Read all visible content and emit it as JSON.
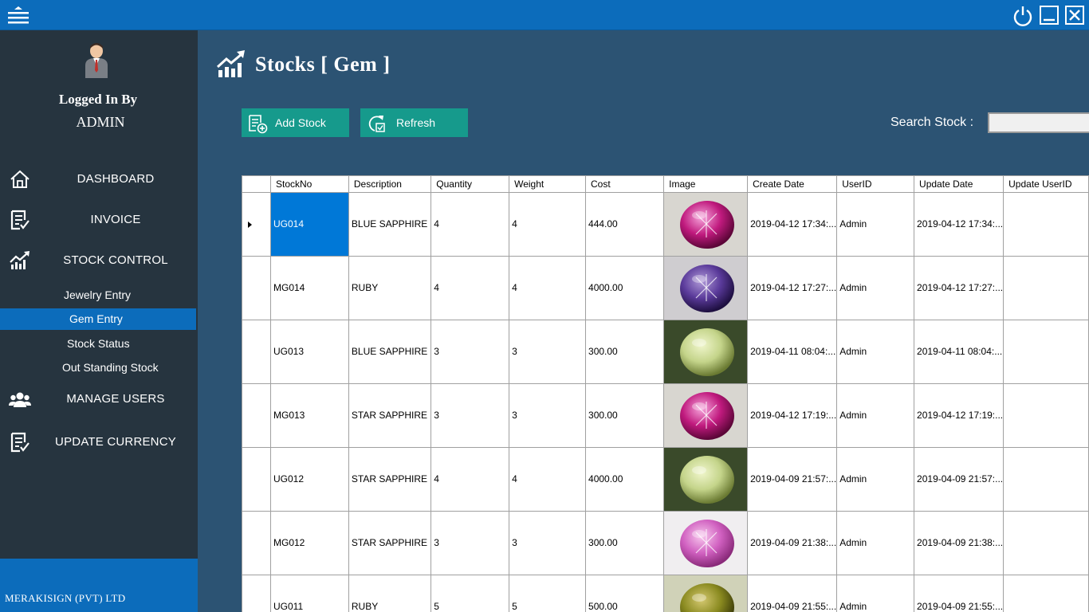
{
  "sidebar": {
    "logged_label": "Logged In By",
    "user": "ADMIN",
    "nav": {
      "dashboard": "DASHBOARD",
      "invoice": "INVOICE",
      "stock_control": "STOCK CONTROL",
      "manage_users": "MANAGE USERS",
      "update_currency": "UPDATE CURRENCY"
    },
    "sub": {
      "jewelry": "Jewelry Entry",
      "gem": "Gem Entry",
      "status": "Stock Status",
      "outstanding": "Out Standing Stock"
    },
    "company": "MERAKISIGN (PVT) LTD"
  },
  "page_title": "Stocks [ Gem ]",
  "toolbar": {
    "add_label": "Add Stock",
    "refresh_label": "Refresh",
    "search_label": "Search Stock  :",
    "search_value": ""
  },
  "table": {
    "columns": {
      "stockno": "StockNo",
      "description": "Description",
      "quantity": "Quantity",
      "weight": "Weight",
      "cost": "Cost",
      "image": "Image",
      "create_date": "Create Date",
      "userid": "UserID",
      "update_date": "Update Date",
      "update_userid": "Update UserID"
    },
    "rows": [
      {
        "stockno": "UG014",
        "description": "BLUE SAPPHIRE",
        "quantity": "4",
        "weight": "4",
        "cost": "444.00",
        "create_date": "2019-04-12 17:34:...",
        "userid": "Admin",
        "update_date": "2019-04-12 17:34:...",
        "update_userid": "",
        "gem": "pink-star"
      },
      {
        "stockno": "MG014",
        "description": "RUBY",
        "quantity": "4",
        "weight": "4",
        "cost": "4000.00",
        "create_date": "2019-04-12 17:27:...",
        "userid": "Admin",
        "update_date": "2019-04-12 17:27:...",
        "update_userid": "",
        "gem": "purple-star"
      },
      {
        "stockno": "UG013",
        "description": "BLUE SAPPHIRE",
        "quantity": "3",
        "weight": "3",
        "cost": "300.00",
        "create_date": "2019-04-11 08:04:...",
        "userid": "Admin",
        "update_date": "2019-04-11 08:04:...",
        "update_userid": "",
        "gem": "green-cabochon"
      },
      {
        "stockno": "MG013",
        "description": "STAR SAPPHIRE",
        "quantity": "3",
        "weight": "3",
        "cost": "300.00",
        "create_date": "2019-04-12 17:19:...",
        "userid": "Admin",
        "update_date": "2019-04-12 17:19:...",
        "update_userid": "",
        "gem": "pink-star"
      },
      {
        "stockno": "UG012",
        "description": "STAR SAPPHIRE",
        "quantity": "4",
        "weight": "4",
        "cost": "4000.00",
        "create_date": "2019-04-09 21:57:...",
        "userid": "Admin",
        "update_date": "2019-04-09 21:57:...",
        "update_userid": "",
        "gem": "green-cabochon"
      },
      {
        "stockno": "MG012",
        "description": "STAR SAPPHIRE",
        "quantity": "3",
        "weight": "3",
        "cost": "300.00",
        "create_date": "2019-04-09 21:38:...",
        "userid": "Admin",
        "update_date": "2019-04-09 21:38:...",
        "update_userid": "",
        "gem": "pink-light"
      },
      {
        "stockno": "UG011",
        "description": "RUBY",
        "quantity": "5",
        "weight": "5",
        "cost": "500.00",
        "create_date": "2019-04-09 21:55:...",
        "userid": "Admin",
        "update_date": "2019-04-09 21:55:...",
        "update_userid": "",
        "gem": "olive-cabochon"
      }
    ]
  },
  "colors": {
    "titlebar": "#0c6cbb",
    "sidebar": "#26343f",
    "content": "#2c5373",
    "button": "#169a8c",
    "selection": "#0078d7"
  }
}
